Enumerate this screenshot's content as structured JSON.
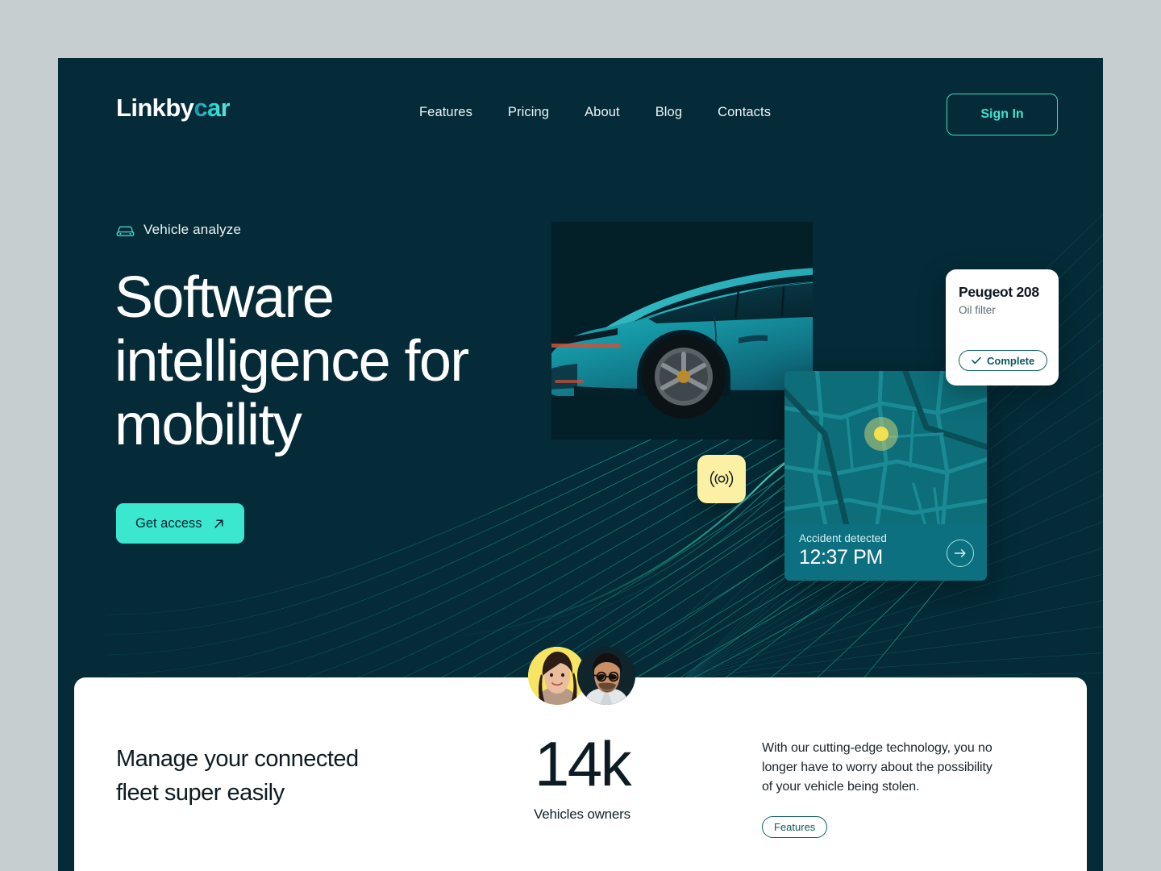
{
  "brand": {
    "name_primary": "Linkby",
    "name_accent": "car"
  },
  "nav": {
    "links": [
      {
        "label": "Features"
      },
      {
        "label": "Pricing"
      },
      {
        "label": "About"
      },
      {
        "label": "Blog"
      },
      {
        "label": "Contacts"
      }
    ],
    "signin_label": "Sign In"
  },
  "hero": {
    "eyebrow": "Vehicle analyze",
    "eyebrow_icon": "car-icon",
    "headline": "Software intelligence for mobility",
    "cta_label": "Get access",
    "cta_icon": "arrow-up-right-icon"
  },
  "service_card": {
    "title": "Peugeot 208",
    "subtitle": "Oil filter",
    "status_label": "Complete",
    "status_icon": "check-icon"
  },
  "map_card": {
    "status": "Accident detected",
    "time": "12:37 PM",
    "action_icon": "arrow-right-icon",
    "pin_icon": "location-pin-icon"
  },
  "signal_badge": {
    "icon": "signal-broadcast-icon"
  },
  "avatars": [
    {
      "name": "avatar-woman"
    },
    {
      "name": "avatar-man"
    }
  ],
  "bottom": {
    "heading": "Manage your connected fleet super easily",
    "stat_value": "14k",
    "stat_caption": "Vehicles owners",
    "paragraph": "With our cutting-edge technology, you no longer have to worry about the possibility of your vehicle being stolen.",
    "features_label": "Features"
  },
  "colors": {
    "page_bg": "#c6cecf",
    "hero_bg": "#042b37",
    "accent_mint": "#3ce7cf",
    "accent_teal": "#46e0cf",
    "card_teal": "#0c7080",
    "badge_yellow": "#fcf0a4",
    "ink": "#0e1b22"
  }
}
